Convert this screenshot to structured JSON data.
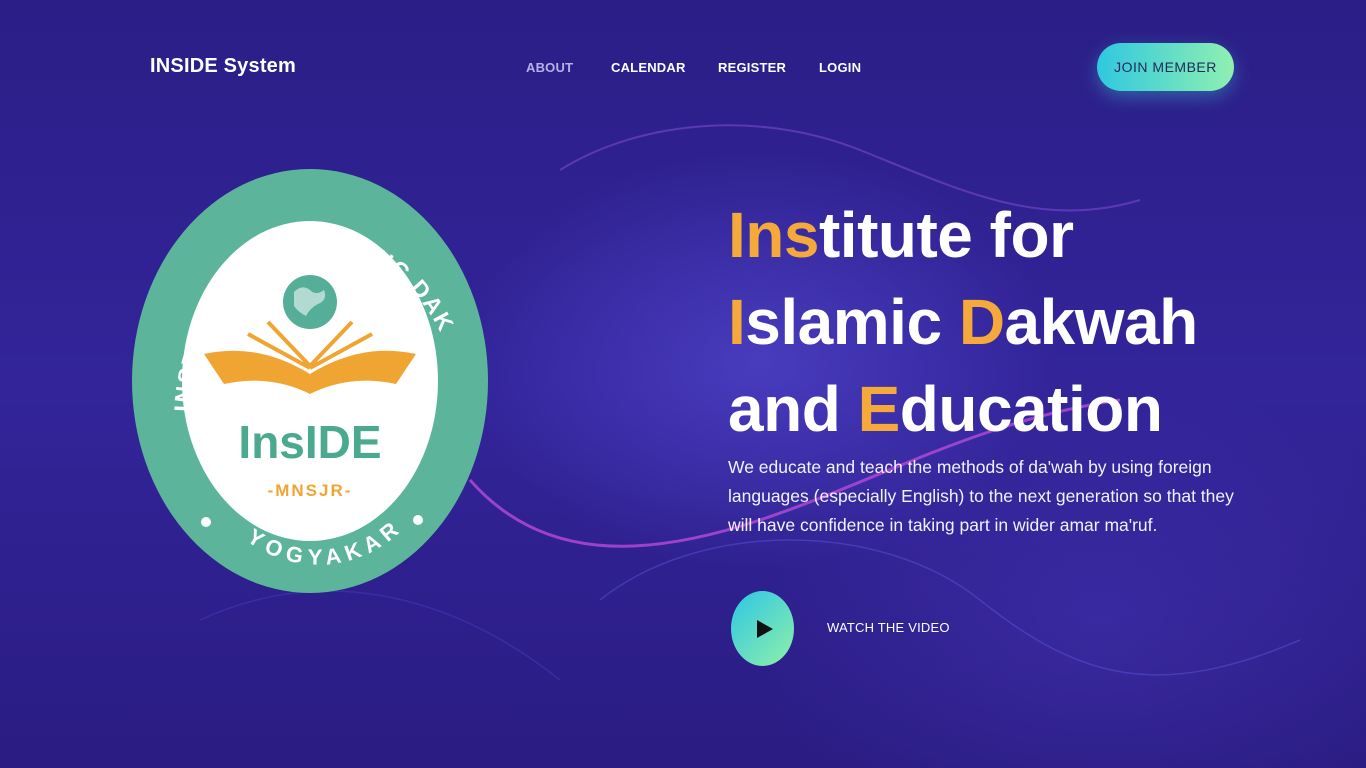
{
  "header": {
    "brand": "INSIDE System",
    "nav": [
      {
        "label": "ABOUT",
        "active": true
      },
      {
        "label": "CALENDAR",
        "active": false
      },
      {
        "label": "REGISTER",
        "active": false
      },
      {
        "label": "LOGIN",
        "active": false
      }
    ],
    "join_button": "JOIN MEMBER"
  },
  "logo": {
    "ring_text_top": "INSTITUTE FOR ISLAMIC DAKWAH AND EDUCATION",
    "ring_text_bottom": "YOGYAKARTA",
    "name": "InsIDE",
    "subname": "-MNSJR-",
    "icon": "globe-and-open-book-icon",
    "colors": {
      "ring": "#5bb49a",
      "book": "#f0a432",
      "inner": "#ffffff"
    }
  },
  "hero": {
    "title_lines": [
      [
        {
          "t": "Ins",
          "hl": true
        },
        {
          "t": "titute for",
          "hl": false
        }
      ],
      [
        {
          "t": "I",
          "hl": true
        },
        {
          "t": "slamic ",
          "hl": false
        },
        {
          "t": "D",
          "hl": true
        },
        {
          "t": "akwah",
          "hl": false
        }
      ],
      [
        {
          "t": "and ",
          "hl": false
        },
        {
          "t": "E",
          "hl": true
        },
        {
          "t": "ducation",
          "hl": false
        }
      ]
    ],
    "description": "We educate and teach the methods of da'wah by using foreign languages (especially English) to the next generation so that they will have confidence in taking part in wider amar ma'ruf.",
    "video_label": "WATCH THE VIDEO",
    "play_icon": "play-icon"
  },
  "colors": {
    "background": "#2e1f8a",
    "highlight": "#f5a93a",
    "button_gradient_start": "#2fc8e0",
    "button_gradient_end": "#8ff0b0"
  }
}
